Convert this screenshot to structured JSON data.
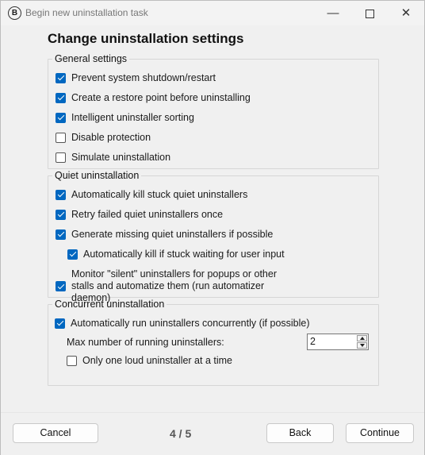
{
  "window": {
    "app_icon_letter": "B",
    "title": "Begin new uninstallation task",
    "minimize_glyph": "—",
    "close_glyph": "✕"
  },
  "heading": "Change uninstallation settings",
  "general": {
    "legend": "General settings",
    "items": [
      {
        "label": "Prevent system shutdown/restart",
        "checked": true
      },
      {
        "label": "Create a restore point before uninstalling",
        "checked": true
      },
      {
        "label": "Intelligent uninstaller sorting",
        "checked": true
      },
      {
        "label": "Disable protection",
        "checked": false
      },
      {
        "label": "Simulate uninstallation",
        "checked": false
      }
    ]
  },
  "quiet": {
    "legend": "Quiet uninstallation",
    "items": [
      {
        "label": "Automatically kill stuck quiet uninstallers",
        "checked": true
      },
      {
        "label": "Retry failed quiet uninstallers once",
        "checked": true
      },
      {
        "label": "Generate missing quiet uninstallers if possible",
        "checked": true
      },
      {
        "label": "Automatically kill if stuck waiting for user input",
        "checked": true
      },
      {
        "label": "Monitor \"silent\" uninstallers for popups or other stalls and automatize them (run automatizer daemon)",
        "checked": true
      }
    ]
  },
  "concurrent": {
    "legend": "Concurrent uninstallation",
    "run_concurrently": {
      "label": "Automatically run uninstallers concurrently (if possible)",
      "checked": true
    },
    "max_label": "Max number of running uninstallers:",
    "max_value": "2",
    "one_loud": {
      "label": "Only one loud uninstaller at a time",
      "checked": false
    }
  },
  "footer": {
    "cancel": "Cancel",
    "page": "4 / 5",
    "back": "Back",
    "continue": "Continue"
  }
}
